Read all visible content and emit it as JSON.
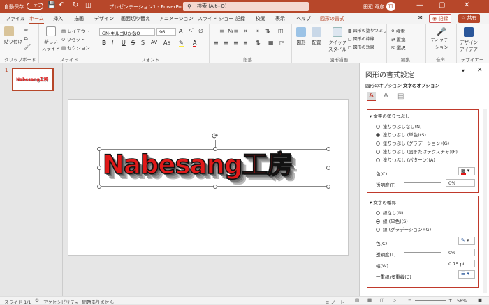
{
  "title": {
    "autosave": "自動保存",
    "autosave_state": "オフ",
    "document": "プレゼンテーション1 - PowerPoint",
    "search": "検索 (Alt+Q)",
    "user": "田辺 竜彦",
    "user_initials": "TT"
  },
  "tabs": [
    "ファイル",
    "ホーム",
    "挿入",
    "描画",
    "デザイン",
    "画面切り替え",
    "アニメーション",
    "スライド ショー",
    "記録",
    "校閲",
    "表示",
    "ヘルプ",
    "図形の書式"
  ],
  "ribbon_right": {
    "record": "記録",
    "share": "共有"
  },
  "ribbon": {
    "clipboard": {
      "paste": "貼り付け",
      "label": "クリップボード"
    },
    "slides": {
      "new": "新しい",
      "new2": "スライド",
      "layout": "レイアウト",
      "reset": "リセット",
      "section": "セクション",
      "label": "スライド"
    },
    "font": {
      "name": "GN-キルゴUかなO",
      "size": "96",
      "label": "フォント",
      "bold": "B",
      "italic": "I",
      "underline": "U",
      "strike": "S",
      "aa": "Aa"
    },
    "paragraph": {
      "label": "段落"
    },
    "drawing": {
      "shapes": "図形",
      "arrange": "配置",
      "quick1": "クイック",
      "quick2": "スタイル",
      "fill": "図形の塗りつぶし",
      "outline": "図形の枠線",
      "effects": "図形の効果",
      "label": "図形描画"
    },
    "editing": {
      "find": "検索",
      "replace": "置換",
      "select": "選択",
      "label": "編集"
    },
    "dictate": {
      "label1": "ディクテー",
      "label2": "ション",
      "group": "音声"
    },
    "designer": {
      "label1": "デザイン",
      "label2": "アイデア",
      "group": "デザイナー"
    }
  },
  "thumbnail": {
    "number": "1",
    "text": "Nabesang工房"
  },
  "slide_text": "Nabesang工房",
  "pane": {
    "title": "図形の書式設定",
    "tab_shape": "図形のオプション",
    "tab_text": "文字のオプション",
    "fill_section": "文字の塗りつぶし",
    "fill_options": [
      "塗りつぶしなし(N)",
      "塗りつぶし (単色)(S)",
      "塗りつぶし (グラデーション)(G)",
      "塗りつぶし (図またはテクスチャ)(P)",
      "塗りつぶし (パターン)(A)"
    ],
    "fill_selected": 1,
    "color_label": "色(C)",
    "transparency_label": "透明度(T)",
    "transparency_value": "0%",
    "outline_section": "文字の輪郭",
    "outline_options": [
      "線なし(N)",
      "線 (単色)(S)",
      "線 (グラデーション)(G)"
    ],
    "outline_selected": 1,
    "outline_color_label": "色(C)",
    "outline_transparency_label": "透明度(T)",
    "outline_transparency_value": "0%",
    "width_label": "幅(W)",
    "width_value": "0.75 pt",
    "compound_label": "一重線/多重線(C)"
  },
  "status": {
    "slide": "スライド 1/1",
    "accessibility": "アクセシビリティ: 問題ありません",
    "notes": "ノート",
    "zoom": "58%"
  },
  "colors": {
    "accent": "#b7472a",
    "text_fill": "#e11919",
    "section_border": "#c0392b"
  }
}
